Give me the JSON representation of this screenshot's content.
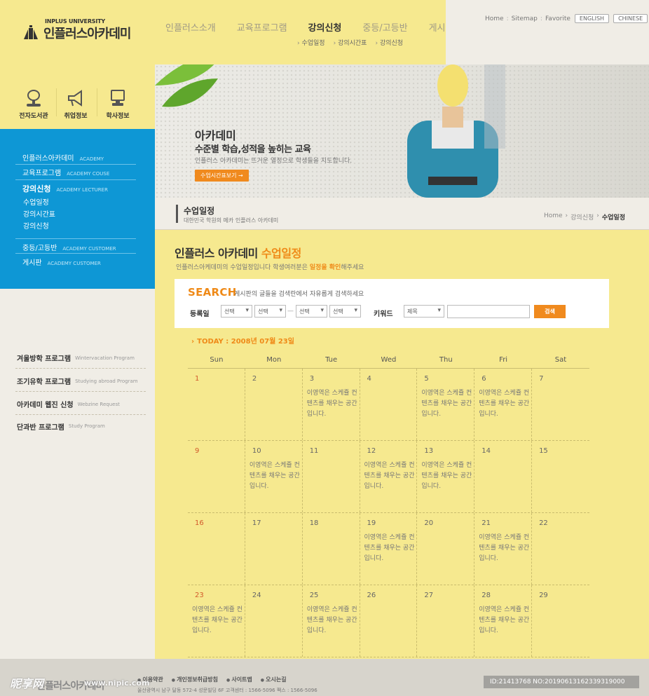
{
  "header": {
    "logo_small": "INPLUS UNIVERSITY",
    "logo_main": "인플러스아카데미",
    "gnb": [
      {
        "label": "인플러스소개"
      },
      {
        "label": "교육프로그램"
      },
      {
        "label": "강의신청"
      },
      {
        "label": "중등/고등반"
      },
      {
        "label": "게시판"
      }
    ],
    "sub_gnb": [
      {
        "label": "수업일정"
      },
      {
        "label": "강의시간표"
      },
      {
        "label": "강의신청"
      }
    ],
    "util": {
      "home": "Home",
      "sitemap": "Sitemap",
      "favorite": "Favorite",
      "english": "ENGLISH",
      "chinese": "CHINESE"
    }
  },
  "quick_menu": [
    {
      "label": "전자도서관",
      "icon": "lamp-icon"
    },
    {
      "label": "취업정보",
      "icon": "megaphone-icon"
    },
    {
      "label": "학사정보",
      "icon": "monitor-icon"
    }
  ],
  "lnb": {
    "items": [
      {
        "ko": "인플러스아카데미",
        "en": "ACADEMY"
      },
      {
        "ko": "교육프로그램",
        "en": "ACADEMY COUSE"
      },
      {
        "ko": "강의신청",
        "en": "ACADEMY LECTURER"
      },
      {
        "ko": "중등/고등반",
        "en": "ACADEMY CUSTOMER"
      },
      {
        "ko": "게시판",
        "en": "ACADEMY CUSTOMER"
      }
    ],
    "sub": [
      "수업일정",
      "강의시간표",
      "강의신청"
    ]
  },
  "side_banners": [
    {
      "ko": "겨울방학 프로그램",
      "en": "Wintervacation Program"
    },
    {
      "ko": "조기유학 프로그램",
      "en": "Studying abroad Program"
    },
    {
      "ko": "아카데미 웹진 신청",
      "en": "Webzine Request"
    },
    {
      "ko": "단과반 프로그램",
      "en": "Study Program"
    }
  ],
  "visual": {
    "title": "아카데미",
    "subtitle": "수준별 학습,성적을 높히는 교육",
    "desc": "인플러스 아카데미는 뜨거운 열정으로 학생들을 지도합니다.",
    "button": "수업시간표보기 →"
  },
  "content_head": {
    "title": "수업일정",
    "subtitle": "대한민국 학원의 메카 인플러스 아카데미",
    "breadcrumb": [
      "Home",
      "강의신청",
      "수업일정"
    ]
  },
  "page": {
    "title_a": "인플러스 아카데미",
    "title_b": "수업일정",
    "desc_a": "인플러스아케데미의 수업일정입니다 학생여러분은",
    "desc_hl": "일정을 확인",
    "desc_b": "해주세요"
  },
  "search": {
    "title": "SEARCH",
    "note": "게시판의 글들을 검색란에서 자유롭게 검색하세요",
    "date_label": "등록일",
    "selects": [
      "선택",
      "선택",
      "선택",
      "선택"
    ],
    "dash": "—",
    "keyword_label": "키워드",
    "keyword_select": "제목",
    "keyword_value": "",
    "button": "검색"
  },
  "calendar": {
    "today": "TODAY : 2008년 07월 23일",
    "weekdays": [
      "Sun",
      "Mon",
      "Tue",
      "Wed",
      "Thu",
      "Fri",
      "Sat"
    ],
    "event_text": "이영역은 스케쥴 컨텐츠를 채우는 공간입니다.",
    "weeks": [
      [
        {
          "d": "1",
          "e": false
        },
        {
          "d": "2",
          "e": false
        },
        {
          "d": "3",
          "e": true
        },
        {
          "d": "4",
          "e": false
        },
        {
          "d": "5",
          "e": true
        },
        {
          "d": "6",
          "e": true
        },
        {
          "d": "7",
          "e": false
        }
      ],
      [
        {
          "d": "9",
          "e": false
        },
        {
          "d": "10",
          "e": true
        },
        {
          "d": "11",
          "e": false
        },
        {
          "d": "12",
          "e": true
        },
        {
          "d": "13",
          "e": true
        },
        {
          "d": "14",
          "e": false
        },
        {
          "d": "15",
          "e": false
        }
      ],
      [
        {
          "d": "16",
          "e": false
        },
        {
          "d": "17",
          "e": false
        },
        {
          "d": "18",
          "e": false
        },
        {
          "d": "19",
          "e": true
        },
        {
          "d": "20",
          "e": false
        },
        {
          "d": "21",
          "e": true
        },
        {
          "d": "22",
          "e": false
        }
      ],
      [
        {
          "d": "23",
          "e": true
        },
        {
          "d": "24",
          "e": false
        },
        {
          "d": "25",
          "e": true
        },
        {
          "d": "26",
          "e": false
        },
        {
          "d": "27",
          "e": false
        },
        {
          "d": "28",
          "e": true
        },
        {
          "d": "29",
          "e": false
        }
      ]
    ]
  },
  "footer": {
    "logo": "인플러스아카데미",
    "links": [
      "이용약관",
      "개인정보취급방침",
      "사이트맵",
      "오시는길"
    ],
    "address": "울산광역시 남구 달동 572-4 성문빌딩 6F 고객센터 : 1566-5096  팩스 : 1566-5096",
    "watermark_left": "昵享网",
    "watermark_url": "www.nipic.com",
    "watermark_id": "ID:21413768 NO:20190613162339319000"
  },
  "colors": {
    "accent": "#ef8a18",
    "lnb_blue": "#0e97d5",
    "yellow": "#f6e98f",
    "sunday": "#d25a2c"
  }
}
